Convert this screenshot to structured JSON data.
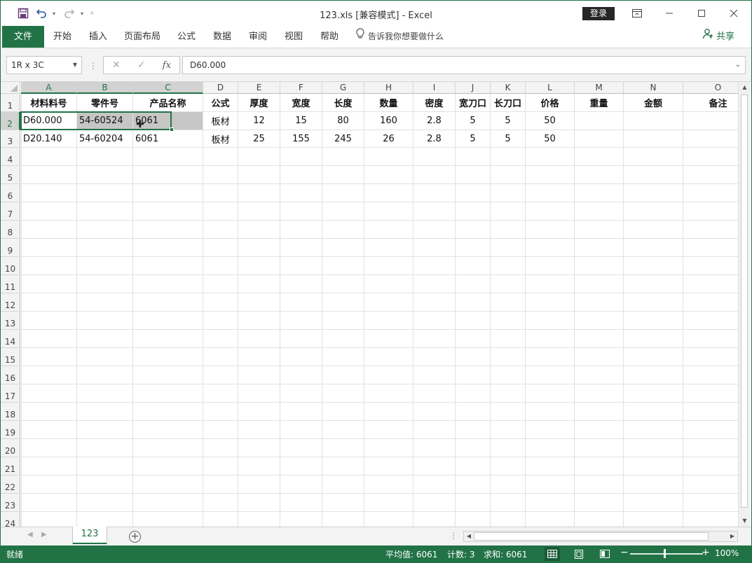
{
  "app": {
    "title": "123.xls  [兼容模式]  -  Excel",
    "login_label": "登录"
  },
  "ribbon": {
    "tabs": [
      "文件",
      "开始",
      "插入",
      "页面布局",
      "公式",
      "数据",
      "审阅",
      "视图",
      "帮助"
    ],
    "tellme": "告诉我你想要做什么",
    "share": "共享"
  },
  "formula_bar": {
    "name_box": "1R x 3C",
    "formula": "D60.000"
  },
  "columns": [
    "A",
    "B",
    "C",
    "D",
    "E",
    "F",
    "G",
    "H",
    "I",
    "J",
    "K",
    "L",
    "M",
    "N",
    "O"
  ],
  "rows": [
    "1",
    "2",
    "3",
    "4",
    "5",
    "6",
    "7",
    "8",
    "9",
    "10",
    "11",
    "12",
    "13",
    "14",
    "15",
    "16",
    "17",
    "18",
    "19",
    "20",
    "21",
    "22",
    "23",
    "24"
  ],
  "sheet": {
    "header": [
      "材料料号",
      "零件号",
      "产品名称",
      "公式",
      "厚度",
      "宽度",
      "长度",
      "数量",
      "密度",
      "宽刀口",
      "长刀口",
      "价格",
      "重量",
      "金额",
      "备注"
    ],
    "data": [
      [
        "D60.000",
        "54-60524",
        "6061",
        "板材",
        "12",
        "15",
        "80",
        "160",
        "2.8",
        "5",
        "5",
        "50",
        "",
        "",
        ""
      ],
      [
        "D20.140",
        "54-60204",
        "6061",
        "板材",
        "25",
        "155",
        "245",
        "26",
        "2.8",
        "5",
        "5",
        "50",
        "",
        "",
        ""
      ]
    ]
  },
  "sheet_tabs": [
    "123"
  ],
  "status": {
    "ready": "就绪",
    "average": "平均值: 6061",
    "count": "计数: 3",
    "sum": "求和: 6061",
    "zoom": "100%"
  }
}
